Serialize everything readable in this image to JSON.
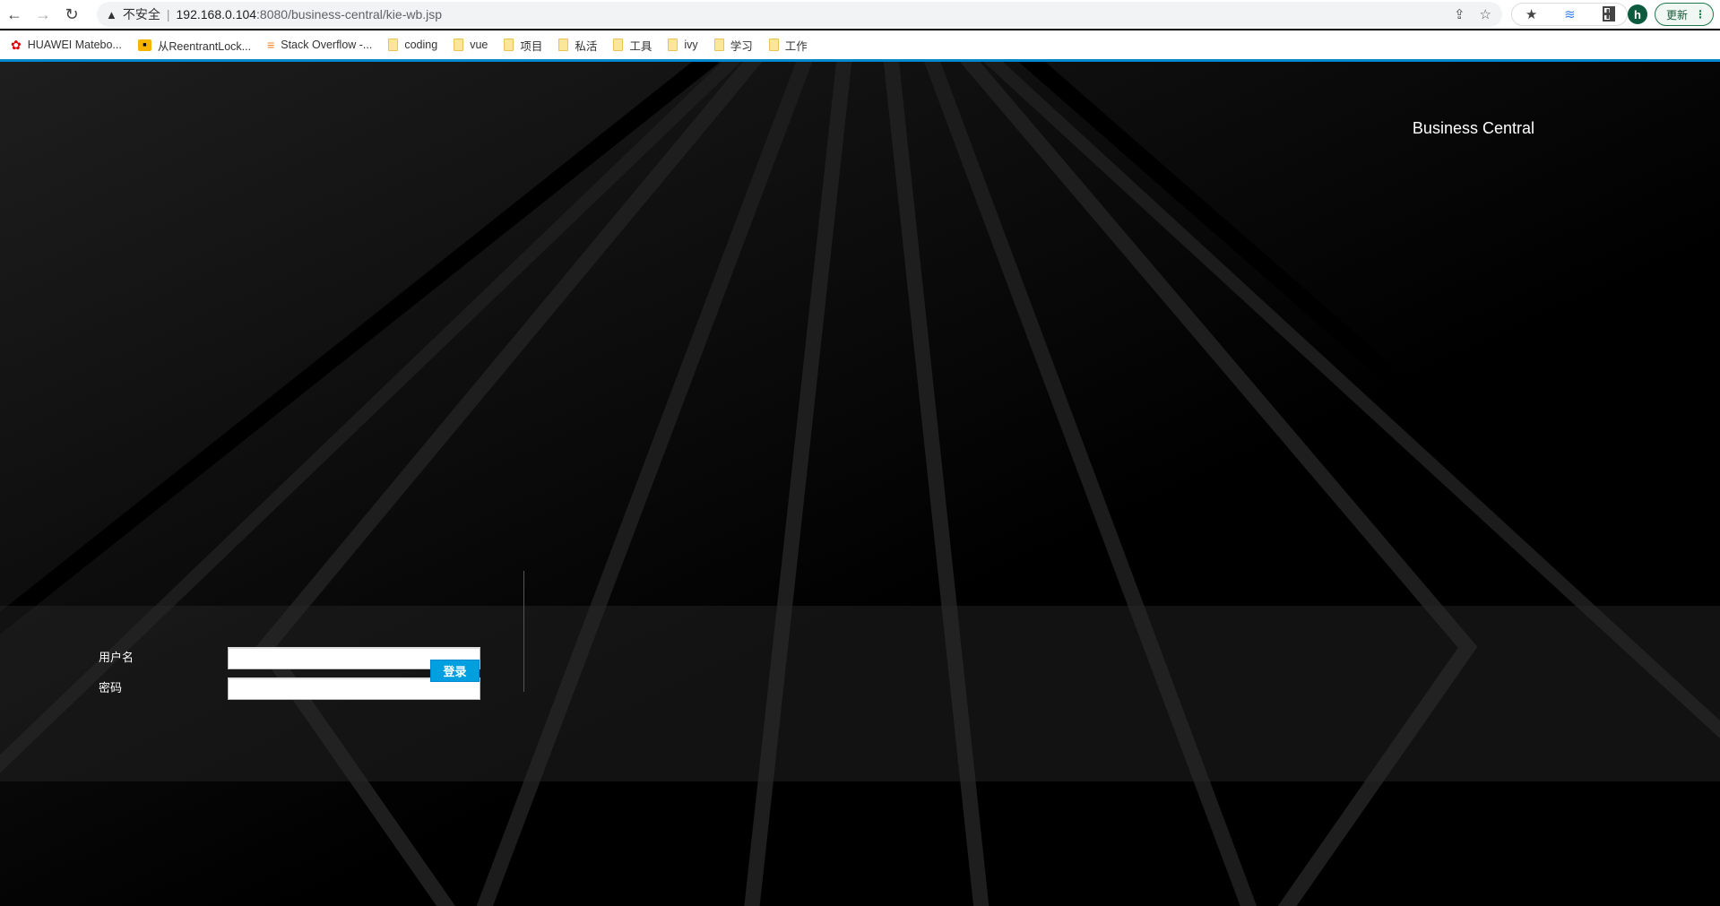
{
  "browser": {
    "security_label": "不安全",
    "url_host": "192.168.0.104",
    "url_rest": ":8080/business-central/kie-wb.jsp",
    "avatar_letter": "h",
    "update_label": "更新",
    "bookmarks": [
      {
        "label": "HUAWEI Matebo...",
        "icon": "huawei-icon"
      },
      {
        "label": "从ReentrantLock...",
        "icon": "site-icon"
      },
      {
        "label": "Stack Overflow -...",
        "icon": "stackoverflow-icon"
      },
      {
        "label": "coding",
        "icon": "folder-icon"
      },
      {
        "label": "vue",
        "icon": "folder-icon"
      },
      {
        "label": "项目",
        "icon": "folder-icon"
      },
      {
        "label": "私活",
        "icon": "folder-icon"
      },
      {
        "label": "工具",
        "icon": "folder-icon"
      },
      {
        "label": "ivy",
        "icon": "folder-icon"
      },
      {
        "label": "学习",
        "icon": "folder-icon"
      },
      {
        "label": "工作",
        "icon": "folder-icon"
      }
    ]
  },
  "page": {
    "brand": "Business Central",
    "username_label": "用户名",
    "username_value": "",
    "password_label": "密码",
    "password_value": "",
    "login_button": "登录",
    "accent_color": "#00a0e0"
  }
}
